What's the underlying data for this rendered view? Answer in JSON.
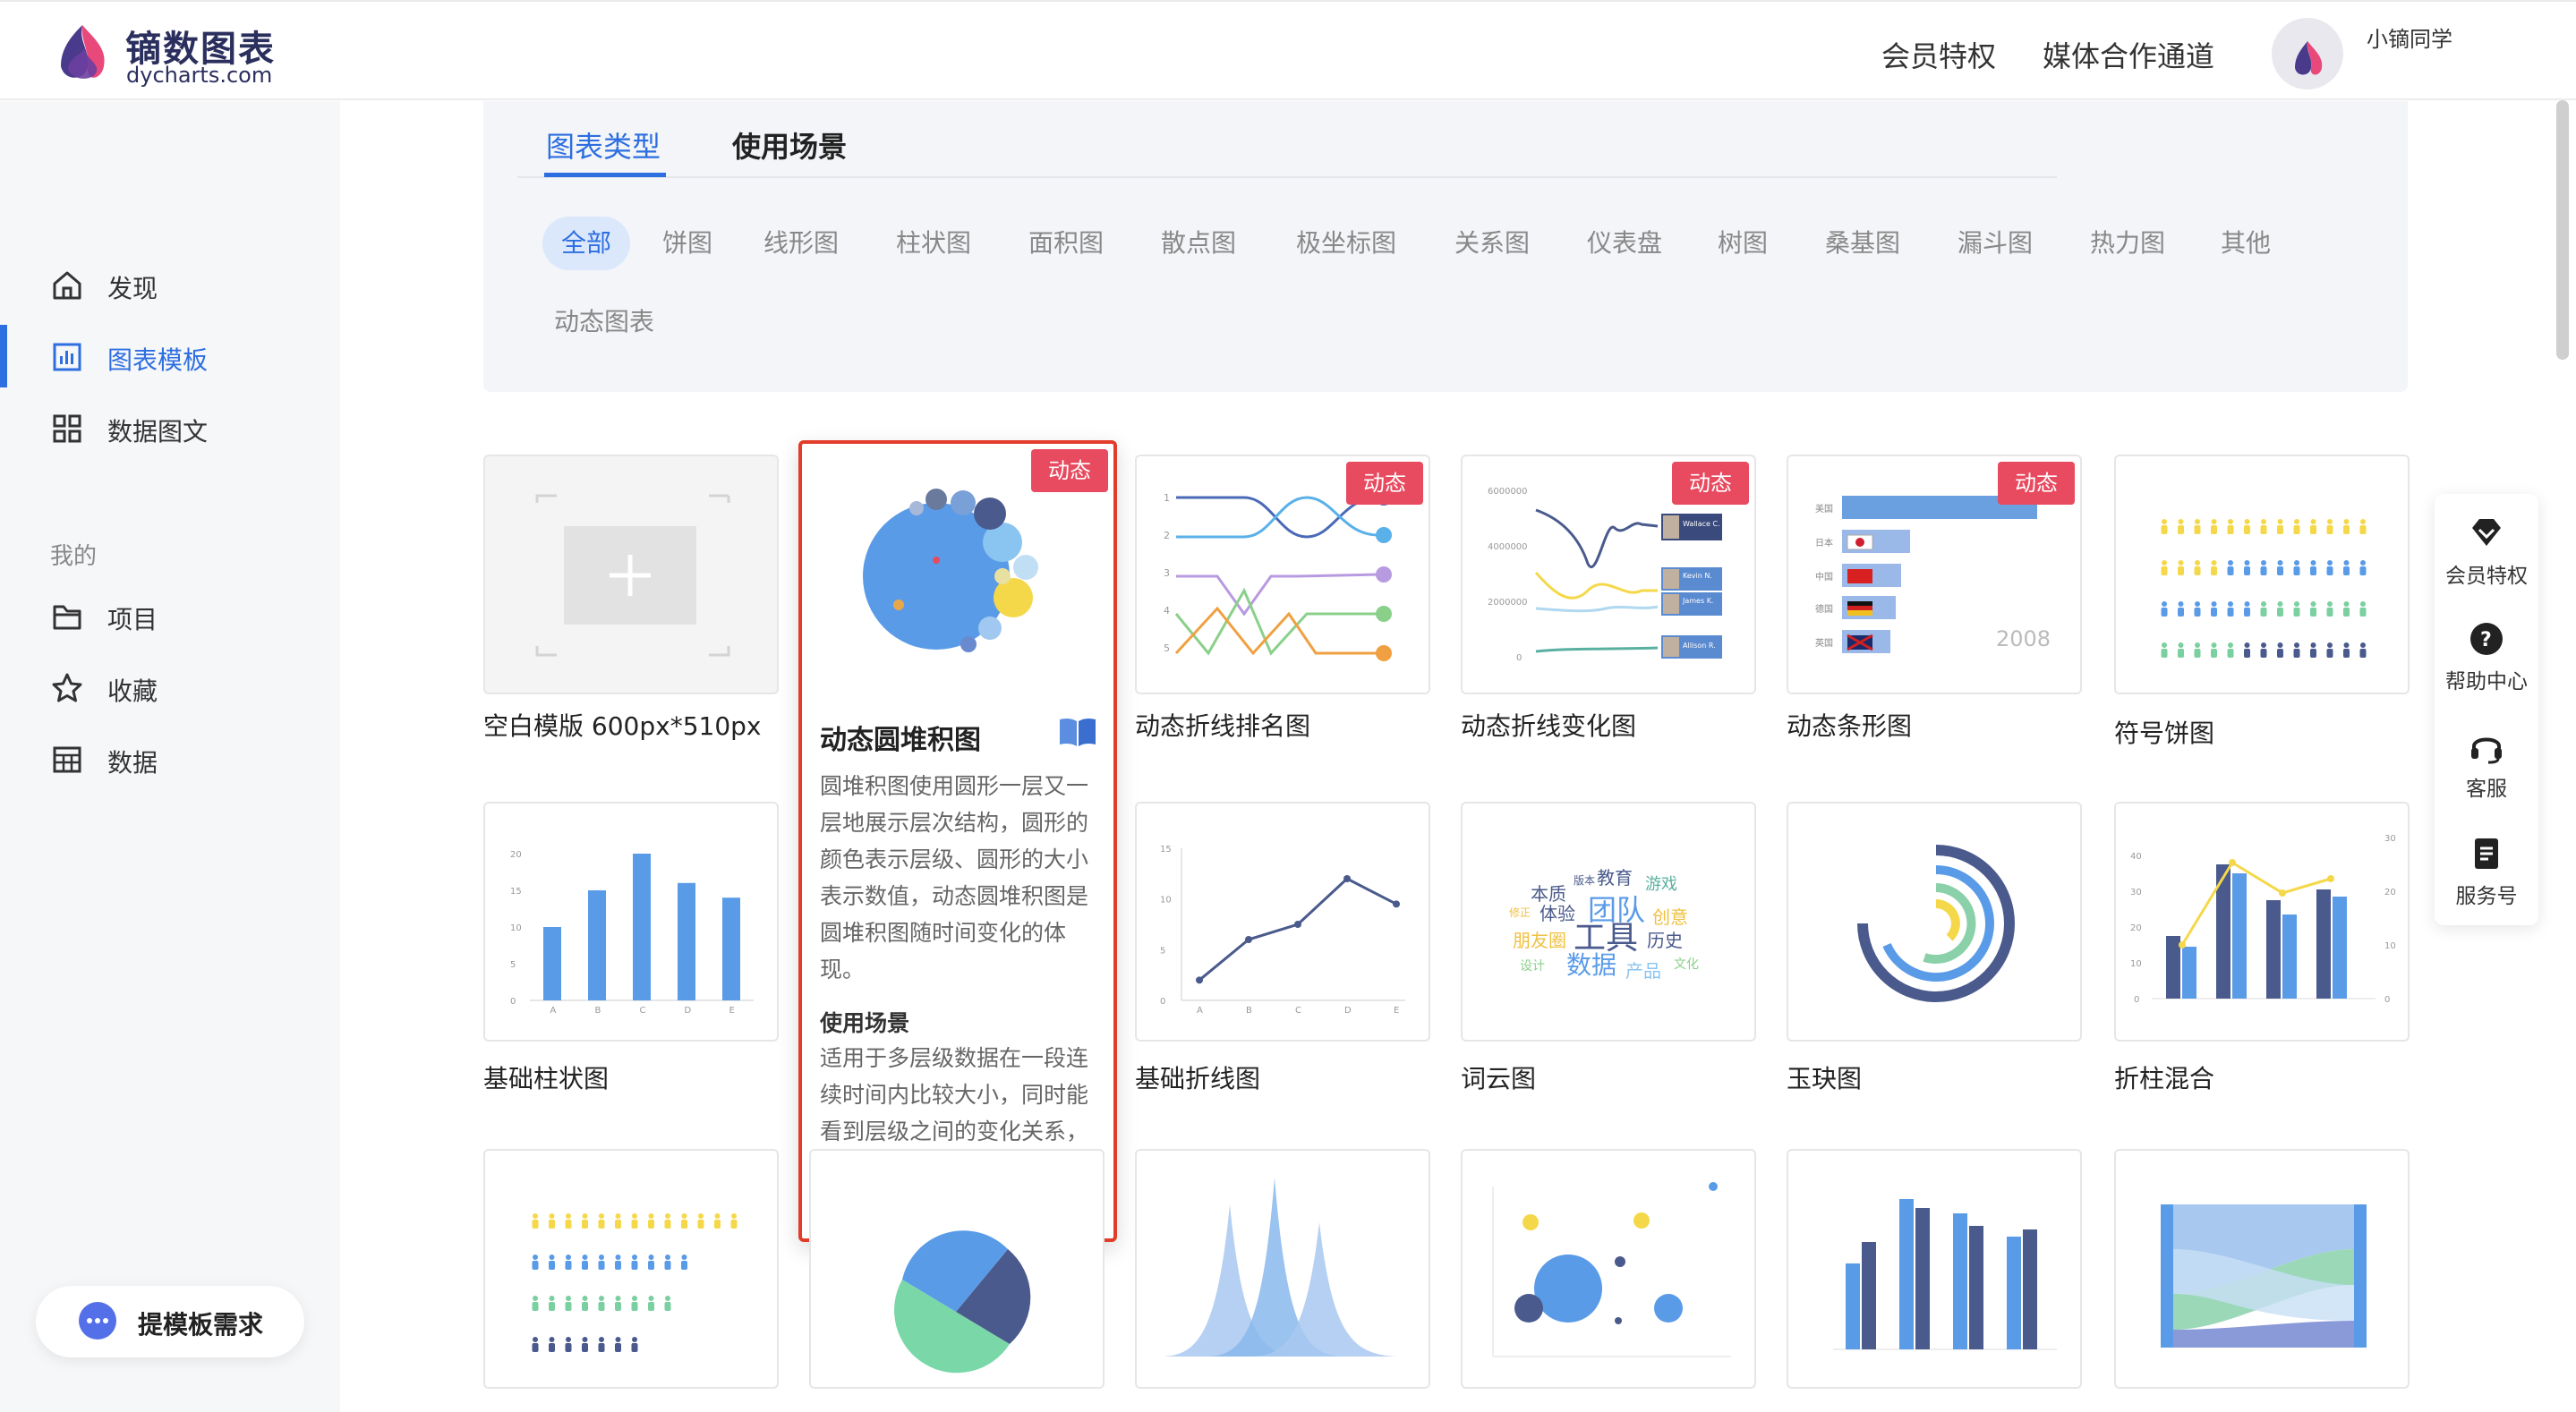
{
  "header": {
    "logo_title": "镝数图表",
    "logo_sub": "dycharts.com",
    "links": [
      "会员特权",
      "媒体合作通道"
    ],
    "username": "小镝同学"
  },
  "sidebar": {
    "items": [
      {
        "label": "发现",
        "icon": "home-icon"
      },
      {
        "label": "图表模板",
        "icon": "chart-template-icon"
      },
      {
        "label": "数据图文",
        "icon": "grid-icon"
      }
    ],
    "group_label": "我的",
    "my_items": [
      {
        "label": "项目",
        "icon": "folder-icon"
      },
      {
        "label": "收藏",
        "icon": "star-icon"
      },
      {
        "label": "数据",
        "icon": "table-icon"
      }
    ],
    "request_button": "提模板需求"
  },
  "tabs": [
    "图表类型",
    "使用场景"
  ],
  "categories": [
    "全部",
    "饼图",
    "线形图",
    "柱状图",
    "面积图",
    "散点图",
    "极坐标图",
    "关系图",
    "仪表盘",
    "树图",
    "桑基图",
    "漏斗图",
    "热力图",
    "其他",
    "动态图表"
  ],
  "badge_label": "动态",
  "cards": [
    {
      "title": "空白模版 600px*510px"
    },
    {
      "title": "动态圆堆积图"
    },
    {
      "title": "动态折线排名图"
    },
    {
      "title": "动态折线变化图"
    },
    {
      "title": "动态条形图"
    },
    {
      "title": "符号饼图"
    },
    {
      "title": "基础柱状图"
    },
    {
      "title": "基础折线图"
    },
    {
      "title": "词云图"
    },
    {
      "title": "玉玦图"
    },
    {
      "title": "折柱混合"
    }
  ],
  "popup": {
    "title": "动态圆堆积图",
    "description": "圆堆积图使用圆形一层又一层地展示层次结构，圆形的颜色表示层级、圆形的大小表示数值，动态圆堆积图是圆堆积图随时间变化的体现。",
    "usage_title": "使用场景",
    "usage_text": "适用于多层级数据在一段连续时间内比较大小，同时能看到层级之间的变化关系，比如新冠疫情全球变化情况。"
  },
  "thumbs": {
    "bar_chart": {
      "yticks": [
        "0",
        "5",
        "10",
        "15",
        "20"
      ],
      "xlabels": [
        "A",
        "B",
        "C",
        "D",
        "E"
      ],
      "values": [
        10,
        15,
        20,
        16,
        14
      ]
    },
    "line_chart": {
      "yticks": [
        "0",
        "5",
        "10",
        "15"
      ],
      "xlabels": [
        "A",
        "B",
        "C",
        "D",
        "E"
      ],
      "values": [
        2,
        6,
        7.5,
        12,
        9.5
      ]
    },
    "line_change_yticks": [
      "6000000",
      "4000000",
      "2000000",
      "0"
    ],
    "line_change_people": [
      "Wallace C.",
      "Kevin N.",
      "James K.",
      "Allison R."
    ],
    "dynamic_bar": {
      "countries": [
        "美国",
        "日本",
        "中国",
        "德国",
        "英国"
      ],
      "year": "2008"
    },
    "mixed_left_ticks": [
      "0",
      "10",
      "20",
      "30",
      "40"
    ],
    "mixed_right_ticks": [
      "0",
      "10",
      "20",
      "30"
    ],
    "word_cloud": [
      "本质",
      "教育",
      "游戏",
      "体验",
      "团队",
      "创意",
      "朋友圈",
      "工具",
      "历史",
      "设计",
      "数据",
      "产品",
      "文化",
      "版本",
      "修正"
    ]
  },
  "right_float": [
    {
      "label": "会员特权",
      "icon": "diamond-icon"
    },
    {
      "label": "帮助中心",
      "icon": "help-icon"
    },
    {
      "label": "客服",
      "icon": "headset-icon"
    },
    {
      "label": "服务号",
      "icon": "doc-icon"
    }
  ],
  "colors": {
    "accent": "#2d6ee0",
    "badge": "#e84a5f",
    "highlight_border": "#e23c2a"
  }
}
